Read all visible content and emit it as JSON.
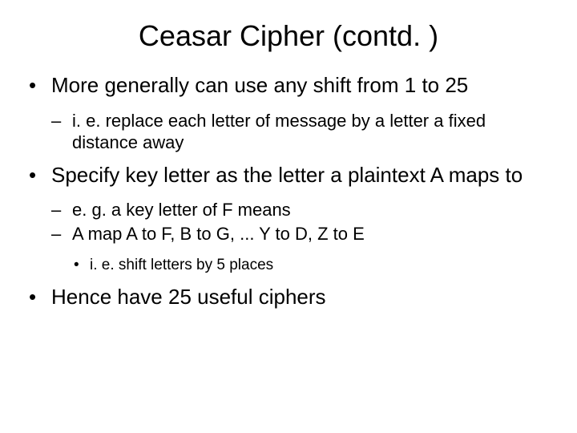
{
  "title": "Ceasar Cipher (contd. )",
  "bullets": [
    {
      "text": "More generally can use any shift from 1 to 25",
      "sub": [
        {
          "text": "i. e. replace each letter of message by a letter a fixed distance away"
        }
      ]
    },
    {
      "text": "Specify key letter as the letter a plaintext A maps to",
      "sub": [
        {
          "text": "e. g. a key letter of F means"
        },
        {
          "text": "A map A to F, B to G, ... Y to D, Z to E",
          "sub": [
            {
              "text": "i. e. shift letters by 5 places"
            }
          ]
        }
      ]
    },
    {
      "text": "Hence have 25 useful ciphers"
    }
  ]
}
